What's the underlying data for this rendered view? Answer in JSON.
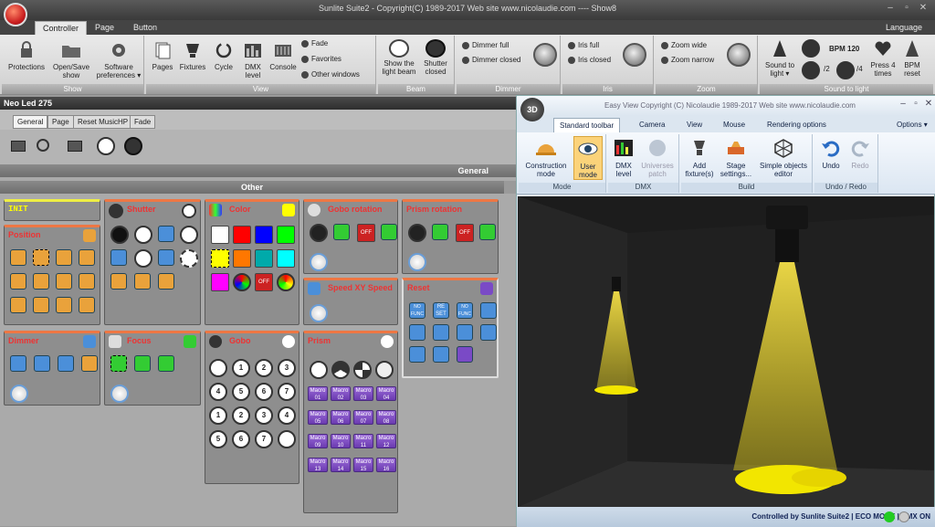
{
  "window": {
    "title": "Sunlite Suite2 - Copyright(C) 1989-2017   Web site www.nicolaudie.com ---- Show8",
    "language": "Language"
  },
  "ribbon": {
    "tabs": [
      "Controller",
      "Page",
      "Button"
    ],
    "groups": {
      "show": "Show",
      "view": "View",
      "beam": "Beam",
      "dimmer": "Dimmer",
      "iris": "Iris",
      "zoom": "Zoom",
      "sound": "Sound to light"
    },
    "show": {
      "protections": "Protections",
      "open_save": "Open/Save\nshow",
      "software_prefs": "Software\npreferences ▾"
    },
    "view": {
      "pages": "Pages",
      "fixtures": "Fixtures",
      "cycle": "Cycle",
      "dmx_level": "DMX\nlevel",
      "console": "Console",
      "fade": "Fade",
      "favorites": "Favorites",
      "other_windows": "Other windows"
    },
    "beam": {
      "show_beam": "Show the\nlight beam",
      "shutter_closed": "Shutter\nclosed"
    },
    "dimmer": {
      "full": "Dimmer full",
      "closed": "Dimmer closed"
    },
    "iris": {
      "full": "Iris full",
      "closed": "Iris closed"
    },
    "zoom": {
      "wide": "Zoom wide",
      "narrow": "Zoom narrow"
    },
    "sound": {
      "btn": "Sound to\nlight ▾",
      "d2": "/2",
      "d4": "/4",
      "bpm": "BPM 120",
      "press4": "Press 4\ntimes",
      "bpm_reset": "BPM\nreset"
    }
  },
  "left": {
    "fixture": "Neo Led 275",
    "tabs": [
      "General",
      "Page",
      "Reset MusicHP",
      "Fade"
    ],
    "general": "General",
    "other": "Other",
    "panels": {
      "init": "INIT",
      "shutter": "Shutter",
      "color": "Color",
      "gobo_rotation": "Gobo rotation",
      "prism_rotation": "Prism rotation",
      "position": "Position",
      "speed": "Speed XY Speed",
      "reset": "Reset",
      "dimmer": "Dimmer",
      "focus": "Focus",
      "gobo": "Gobo",
      "prism": "Prism"
    },
    "reset_buttons": [
      "NO\nFUNC",
      "RE\nSET",
      "NO\nFUNC"
    ],
    "macros": [
      "Macro\n01",
      "Macro\n02",
      "Macro\n03",
      "Macro\n04",
      "Macro\n05",
      "Macro\n06",
      "Macro\n07",
      "Macro\n08",
      "Macro\n09",
      "Macro\n10",
      "Macro\n11",
      "Macro\n12",
      "Macro\n13",
      "Macro\n14",
      "Macro\n15",
      "Macro\n16"
    ],
    "gobo_nums": [
      "1",
      "2",
      "3",
      "4",
      "5",
      "6",
      "7",
      "1",
      "2",
      "3",
      "4",
      "5",
      "6",
      "7"
    ],
    "off": "OFF"
  },
  "easyview": {
    "title": "Easy View   Copyright (C) Nicolaudie 1989-2017    Web site www.nicolaudie.com",
    "badge": "3D",
    "tabs": [
      "Standard toolbar",
      "Camera",
      "View",
      "Mouse",
      "Rendering options"
    ],
    "options": "Options ▾",
    "groups": {
      "mode": "Mode",
      "dmx": "DMX",
      "build": "Build",
      "undo": "Undo / Redo"
    },
    "buttons": {
      "construction": "Construction\nmode",
      "user": "User\nmode",
      "dmx_level": "DMX\nlevel",
      "universes": "Universes\npatch",
      "add_fixture": "Add\nfixture(s)",
      "stage": "Stage\nsettings...",
      "simple_objects": "Simple objects\neditor",
      "undo": "Undo",
      "redo": "Redo"
    },
    "status": "Controlled by Sunlite Suite2  |  ECO MODE  |  DMX ON"
  },
  "colors": {
    "accent_red": "#e33",
    "yellow": "#f2e600",
    "purple": "#7a4ac6"
  }
}
